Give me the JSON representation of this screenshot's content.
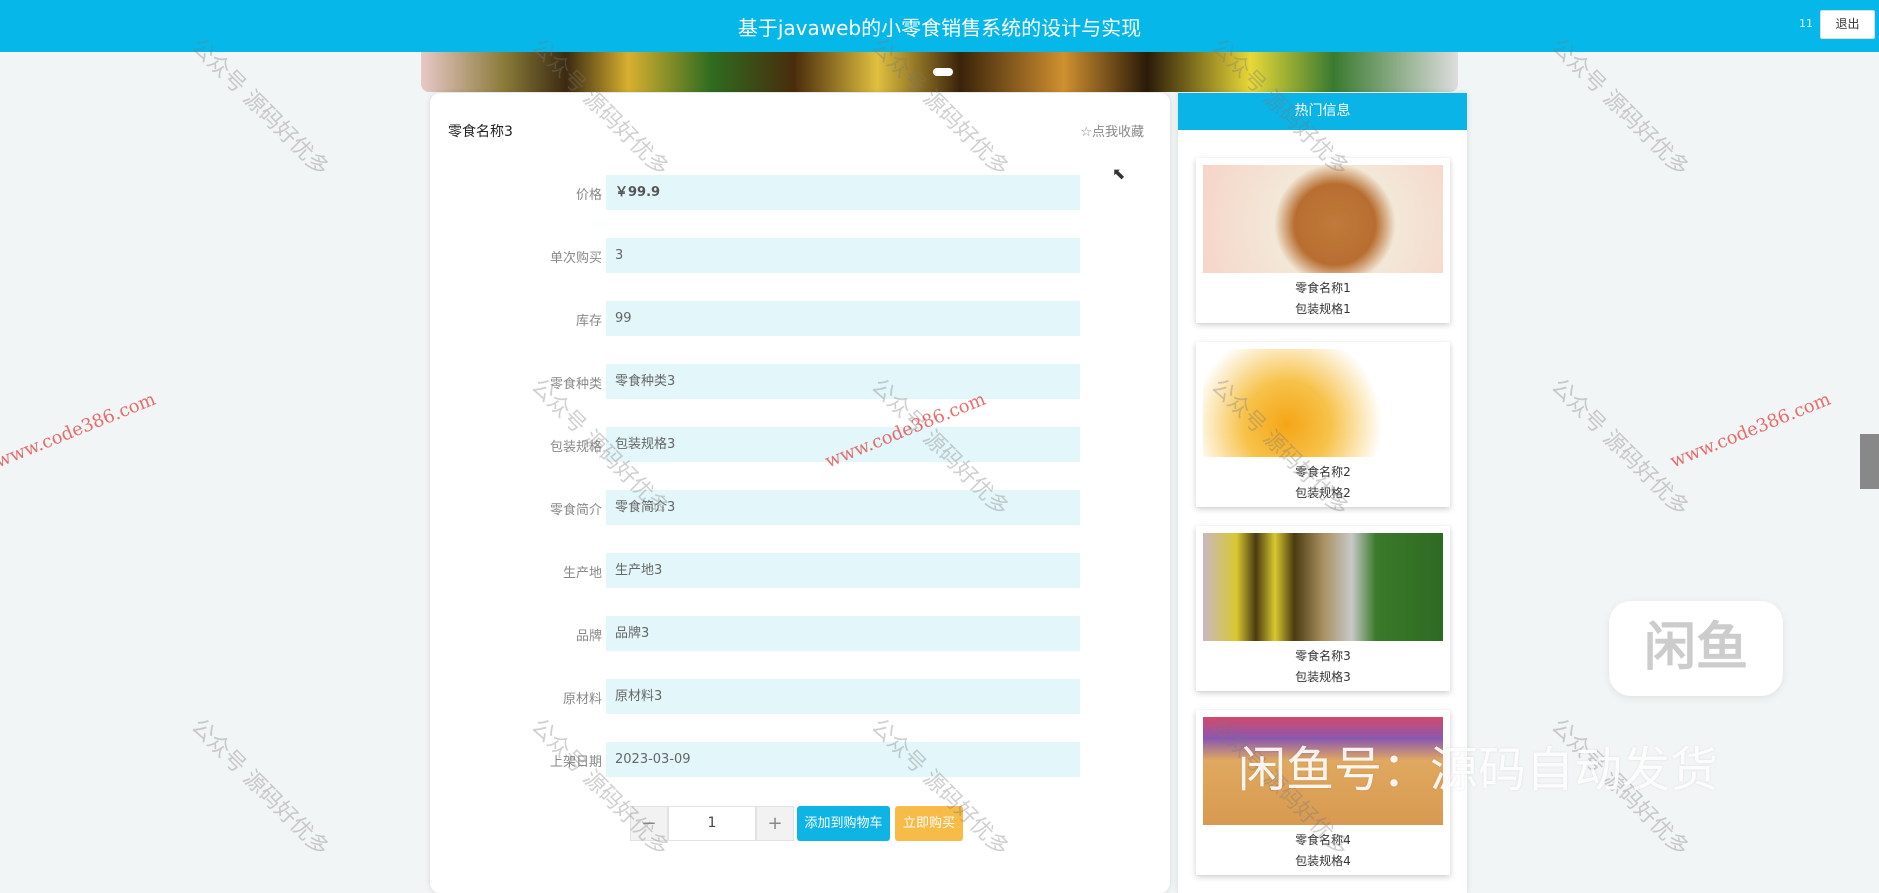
{
  "header": {
    "title": "基于javaweb的小零食销售系统的设计与实现",
    "user": "11",
    "logout": "退出"
  },
  "product": {
    "name": "零食名称3",
    "favorite": "☆点我收藏",
    "fields": [
      {
        "label": "价格",
        "value": "￥99.9"
      },
      {
        "label": "单次购买",
        "value": "3"
      },
      {
        "label": "库存",
        "value": "99"
      },
      {
        "label": "零食种类",
        "value": "零食种类3"
      },
      {
        "label": "包装规格",
        "value": "包装规格3"
      },
      {
        "label": "零食简介",
        "value": "零食简介3"
      },
      {
        "label": "生产地",
        "value": "生产地3"
      },
      {
        "label": "品牌",
        "value": "品牌3"
      },
      {
        "label": "原材料",
        "value": "原材料3"
      },
      {
        "label": "上架日期",
        "value": "2023-03-09"
      }
    ],
    "quantity": "1",
    "minus": "−",
    "plus": "+",
    "add_cart": "添加到购物车",
    "buy_now": "立即购买"
  },
  "hot": {
    "title": "热门信息",
    "items": [
      {
        "name": "零食名称1",
        "spec": "包装规格1"
      },
      {
        "name": "零食名称2",
        "spec": "包装规格2"
      },
      {
        "name": "零食名称3",
        "spec": "包装规格3"
      },
      {
        "name": "零食名称4",
        "spec": "包装规格4"
      }
    ]
  },
  "watermarks": {
    "gzh": "公众号 源码好优多",
    "site": "www.code386.com",
    "xianyu_logo": "闲鱼",
    "xianyu_text": "闲鱼号：源码自动发货"
  }
}
